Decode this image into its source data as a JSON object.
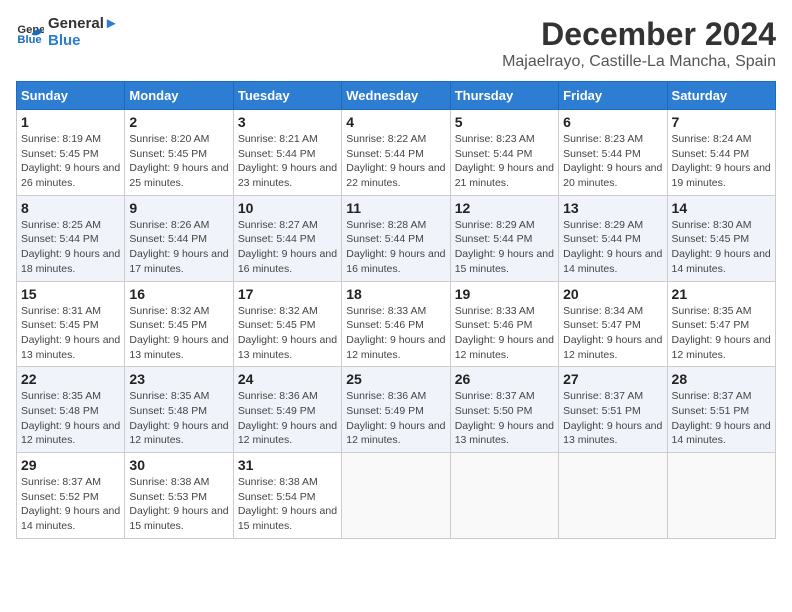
{
  "logo": {
    "text_general": "General",
    "text_blue": "Blue"
  },
  "title": {
    "month": "December 2024",
    "location": "Majaelrayo, Castille-La Mancha, Spain"
  },
  "weekdays": [
    "Sunday",
    "Monday",
    "Tuesday",
    "Wednesday",
    "Thursday",
    "Friday",
    "Saturday"
  ],
  "weeks": [
    [
      {
        "day": "1",
        "sunrise": "8:19 AM",
        "sunset": "5:45 PM",
        "daylight": "9 hours and 26 minutes."
      },
      {
        "day": "2",
        "sunrise": "8:20 AM",
        "sunset": "5:45 PM",
        "daylight": "9 hours and 25 minutes."
      },
      {
        "day": "3",
        "sunrise": "8:21 AM",
        "sunset": "5:44 PM",
        "daylight": "9 hours and 23 minutes."
      },
      {
        "day": "4",
        "sunrise": "8:22 AM",
        "sunset": "5:44 PM",
        "daylight": "9 hours and 22 minutes."
      },
      {
        "day": "5",
        "sunrise": "8:23 AM",
        "sunset": "5:44 PM",
        "daylight": "9 hours and 21 minutes."
      },
      {
        "day": "6",
        "sunrise": "8:23 AM",
        "sunset": "5:44 PM",
        "daylight": "9 hours and 20 minutes."
      },
      {
        "day": "7",
        "sunrise": "8:24 AM",
        "sunset": "5:44 PM",
        "daylight": "9 hours and 19 minutes."
      }
    ],
    [
      {
        "day": "8",
        "sunrise": "8:25 AM",
        "sunset": "5:44 PM",
        "daylight": "9 hours and 18 minutes."
      },
      {
        "day": "9",
        "sunrise": "8:26 AM",
        "sunset": "5:44 PM",
        "daylight": "9 hours and 17 minutes."
      },
      {
        "day": "10",
        "sunrise": "8:27 AM",
        "sunset": "5:44 PM",
        "daylight": "9 hours and 16 minutes."
      },
      {
        "day": "11",
        "sunrise": "8:28 AM",
        "sunset": "5:44 PM",
        "daylight": "9 hours and 16 minutes."
      },
      {
        "day": "12",
        "sunrise": "8:29 AM",
        "sunset": "5:44 PM",
        "daylight": "9 hours and 15 minutes."
      },
      {
        "day": "13",
        "sunrise": "8:29 AM",
        "sunset": "5:44 PM",
        "daylight": "9 hours and 14 minutes."
      },
      {
        "day": "14",
        "sunrise": "8:30 AM",
        "sunset": "5:45 PM",
        "daylight": "9 hours and 14 minutes."
      }
    ],
    [
      {
        "day": "15",
        "sunrise": "8:31 AM",
        "sunset": "5:45 PM",
        "daylight": "9 hours and 13 minutes."
      },
      {
        "day": "16",
        "sunrise": "8:32 AM",
        "sunset": "5:45 PM",
        "daylight": "9 hours and 13 minutes."
      },
      {
        "day": "17",
        "sunrise": "8:32 AM",
        "sunset": "5:45 PM",
        "daylight": "9 hours and 13 minutes."
      },
      {
        "day": "18",
        "sunrise": "8:33 AM",
        "sunset": "5:46 PM",
        "daylight": "9 hours and 12 minutes."
      },
      {
        "day": "19",
        "sunrise": "8:33 AM",
        "sunset": "5:46 PM",
        "daylight": "9 hours and 12 minutes."
      },
      {
        "day": "20",
        "sunrise": "8:34 AM",
        "sunset": "5:47 PM",
        "daylight": "9 hours and 12 minutes."
      },
      {
        "day": "21",
        "sunrise": "8:35 AM",
        "sunset": "5:47 PM",
        "daylight": "9 hours and 12 minutes."
      }
    ],
    [
      {
        "day": "22",
        "sunrise": "8:35 AM",
        "sunset": "5:48 PM",
        "daylight": "9 hours and 12 minutes."
      },
      {
        "day": "23",
        "sunrise": "8:35 AM",
        "sunset": "5:48 PM",
        "daylight": "9 hours and 12 minutes."
      },
      {
        "day": "24",
        "sunrise": "8:36 AM",
        "sunset": "5:49 PM",
        "daylight": "9 hours and 12 minutes."
      },
      {
        "day": "25",
        "sunrise": "8:36 AM",
        "sunset": "5:49 PM",
        "daylight": "9 hours and 12 minutes."
      },
      {
        "day": "26",
        "sunrise": "8:37 AM",
        "sunset": "5:50 PM",
        "daylight": "9 hours and 13 minutes."
      },
      {
        "day": "27",
        "sunrise": "8:37 AM",
        "sunset": "5:51 PM",
        "daylight": "9 hours and 13 minutes."
      },
      {
        "day": "28",
        "sunrise": "8:37 AM",
        "sunset": "5:51 PM",
        "daylight": "9 hours and 14 minutes."
      }
    ],
    [
      {
        "day": "29",
        "sunrise": "8:37 AM",
        "sunset": "5:52 PM",
        "daylight": "9 hours and 14 minutes."
      },
      {
        "day": "30",
        "sunrise": "8:38 AM",
        "sunset": "5:53 PM",
        "daylight": "9 hours and 15 minutes."
      },
      {
        "day": "31",
        "sunrise": "8:38 AM",
        "sunset": "5:54 PM",
        "daylight": "9 hours and 15 minutes."
      },
      null,
      null,
      null,
      null
    ]
  ]
}
